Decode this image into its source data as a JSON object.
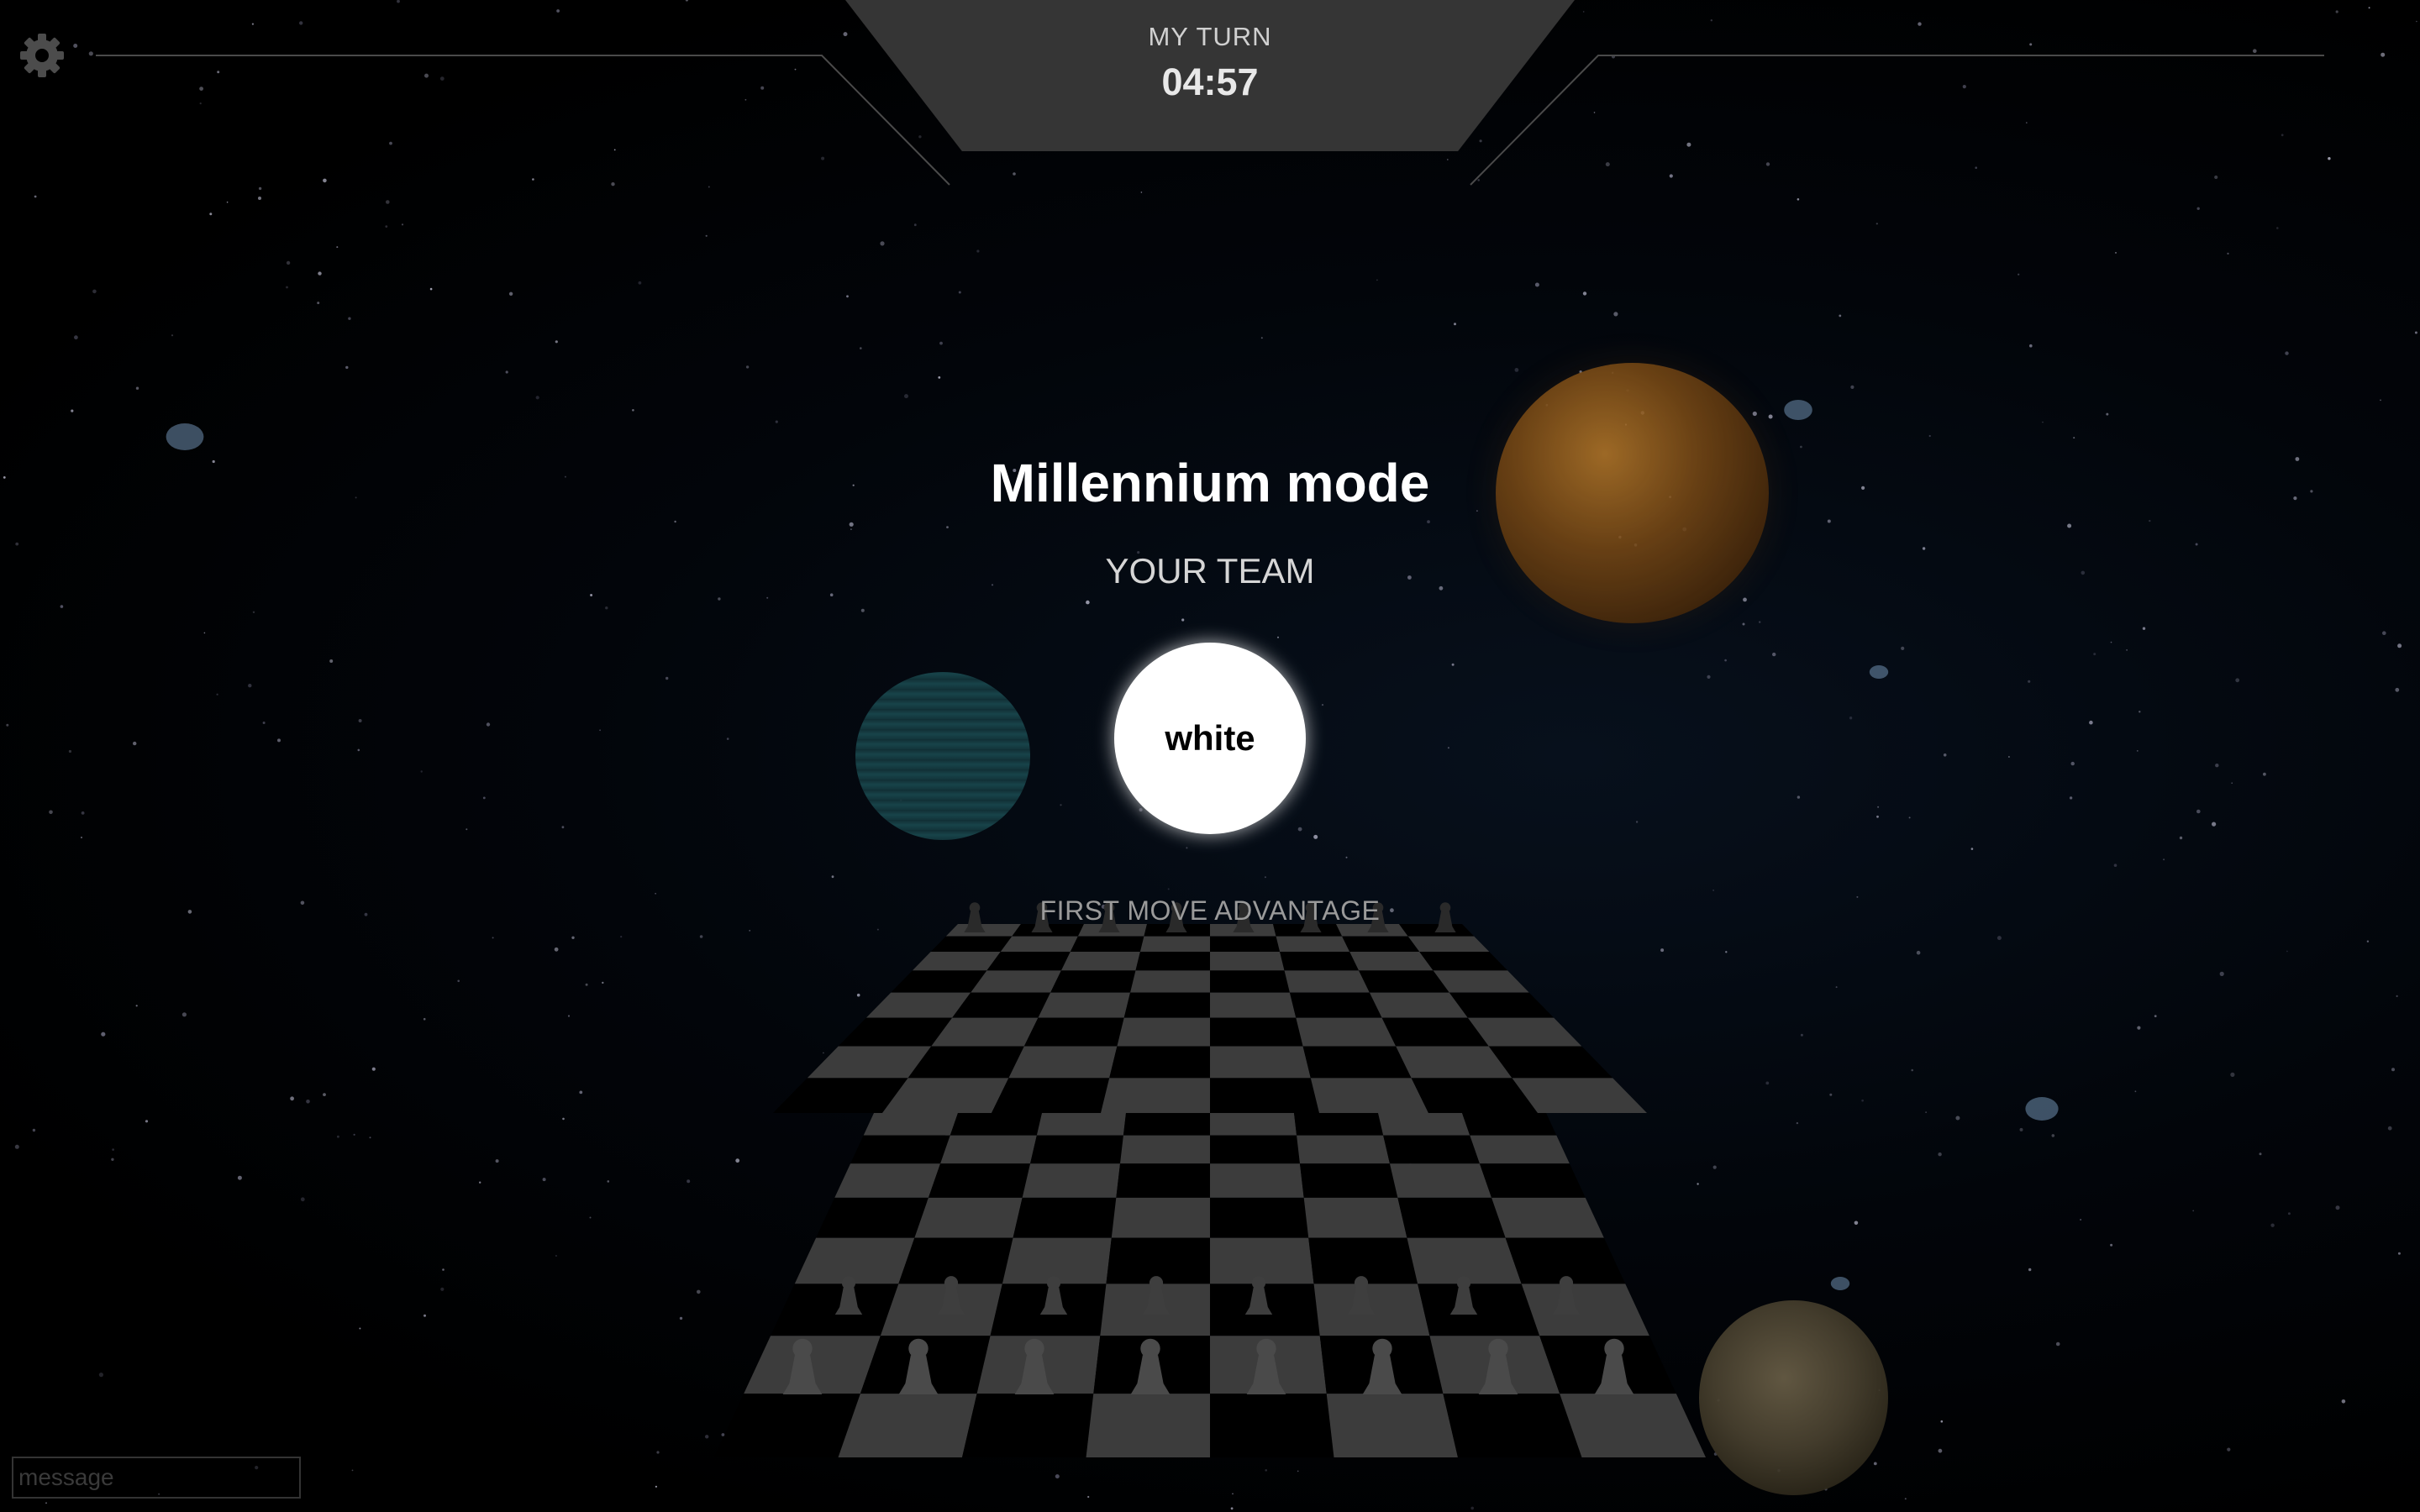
{
  "hud": {
    "turn_label": "MY TURN",
    "timer": "04:57",
    "settings_icon": "gear-icon"
  },
  "overlay": {
    "mode_title": "Millennium mode",
    "team_label": "YOUR TEAM",
    "team_name": "white",
    "first_move_note": "FIRST MOVE ADVANTAGE"
  },
  "chat": {
    "placeholder": "message"
  },
  "board": {
    "ranks": 8,
    "files": 8,
    "light_square_color": "#3c3c3c",
    "dark_square_color": "#000000"
  },
  "colors": {
    "hud_panel": "#353535",
    "hud_line": "#4a4a4a",
    "team_circle": "#ffffff"
  }
}
